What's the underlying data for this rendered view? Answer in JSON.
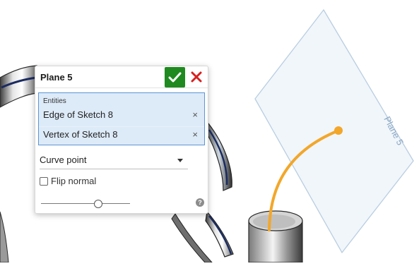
{
  "dialog": {
    "title": "Plane 5",
    "accept_icon": "checkmark-icon",
    "cancel_icon": "close-icon",
    "entities": {
      "label": "Entities",
      "items": [
        {
          "label": "Edge of Sketch 8",
          "remove": "×"
        },
        {
          "label": "Vertex of Sketch 8",
          "remove": "×"
        }
      ]
    },
    "type_select": {
      "value": "Curve point"
    },
    "flip_normal": {
      "label": "Flip normal",
      "checked": false
    },
    "position_slider": {
      "value": 0.66
    },
    "help": {
      "label": "?"
    }
  },
  "viewport": {
    "plane_label": "Plane 5",
    "colors": {
      "accent": "#1f8a1f",
      "cancel": "#d62020",
      "curve": "#f2a72a",
      "plane_edge": "#b9cde0",
      "selection": "#5d95d4"
    }
  }
}
